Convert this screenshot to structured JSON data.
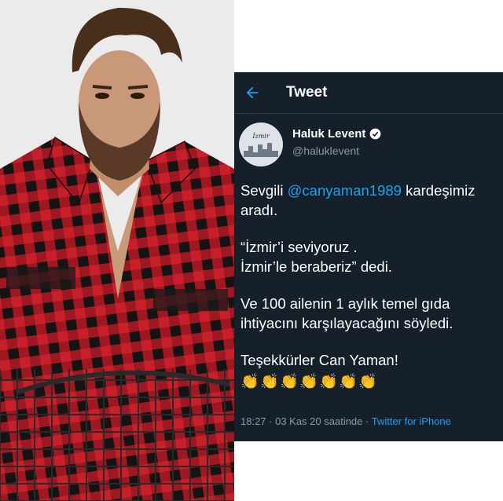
{
  "photo": {
    "subject": "man-in-checked-shirt",
    "shirt_colors": [
      "#c8202a",
      "#151515"
    ]
  },
  "tweet_header": {
    "title": "Tweet",
    "back_icon": "arrow-left-icon",
    "accent": "#1da1f2"
  },
  "author": {
    "display_name": "Haluk Levent",
    "handle": "@haluklevent",
    "avatar_text": "İzmir",
    "verified_icon": "verified-badge-icon"
  },
  "tweet": {
    "line1_prefix": "Sevgili ",
    "mention": "@canyaman1989",
    "line1_suffix": " kardeşimiz",
    "line2": "aradı.",
    "quote1": "“İzmir’i seviyoruz .",
    "quote2": "İzmir’le beraberiz” dedi.",
    "line3": "Ve 100 ailenin 1 aylık temel gıda",
    "line4": "ihtiyacını karşılayacağını söyledi.",
    "thanks": "Teşekkürler Can Yaman!",
    "claps": [
      "👏",
      "👏",
      "👏",
      "👏",
      "👏",
      "👏",
      "👏"
    ]
  },
  "meta": {
    "time": "18:27 · 03 Kas 20 saatinde · ",
    "client": "Twitter for iPhone"
  },
  "colors": {
    "panel_bg": "#15202b",
    "muted": "#8899a6",
    "link": "#1da1f2"
  }
}
